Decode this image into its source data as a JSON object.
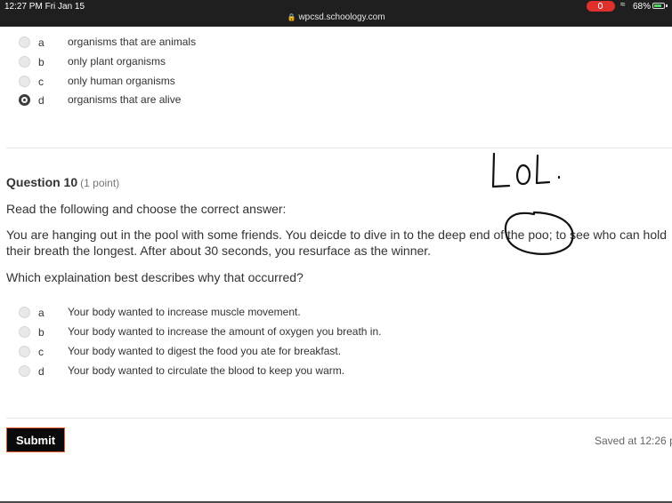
{
  "status_bar": {
    "time": "12:27 PM   Fri Jan 15",
    "url": "wpcsd.schoology.com",
    "battery": "68%"
  },
  "prev_options": [
    {
      "letter": "a",
      "text": "organisms that are animals",
      "selected": false
    },
    {
      "letter": "b",
      "text": "only plant organisms",
      "selected": false
    },
    {
      "letter": "c",
      "text": "only human organisms",
      "selected": false
    },
    {
      "letter": "d",
      "text": "organisms that are alive",
      "selected": true
    }
  ],
  "question": {
    "title": "Question 10",
    "points": "(1 point)",
    "instruction": "Read the following and choose the correct answer:",
    "line1": "You are hanging out in the pool with some friends. You deicde to dive in to the deep end of the poo; to see who can hold",
    "line2": "their breath the longest.  After about 30 seconds, you resurface as the winner.",
    "prompt": "Which explaination best describes why that occurred?",
    "options": [
      {
        "letter": "a",
        "text": "Your body wanted to increase muscle movement.",
        "selected": false
      },
      {
        "letter": "b",
        "text": "Your body wanted to increase the amount of oxygen you breath in.",
        "selected": false
      },
      {
        "letter": "c",
        "text": "Your body wanted to digest the food you ate for breakfast.",
        "selected": false
      },
      {
        "letter": "d",
        "text": "Your body wanted to circulate the blood to keep you warm.",
        "selected": false
      }
    ]
  },
  "footer": {
    "submit_label": "Submit",
    "saved_text": "Saved at 12:26 p"
  },
  "annotation": {
    "text": "LoL."
  }
}
